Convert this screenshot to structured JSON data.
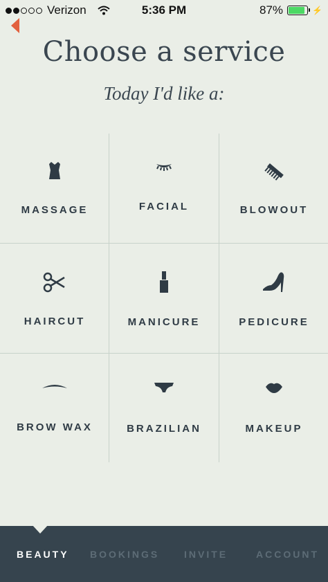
{
  "status_bar": {
    "carrier": "Verizon",
    "time": "5:36 PM",
    "battery_percent": "87%",
    "battery_level": 0.87
  },
  "header": {
    "title": "Choose a service",
    "subtitle": "Today I'd like a:",
    "back_icon": "chevron-left-icon"
  },
  "services": [
    {
      "label": "MASSAGE",
      "icon": "corset-icon"
    },
    {
      "label": "FACIAL",
      "icon": "eyelash-icon"
    },
    {
      "label": "BLOWOUT",
      "icon": "comb-icon"
    },
    {
      "label": "HAIRCUT",
      "icon": "scissors-icon"
    },
    {
      "label": "MANICURE",
      "icon": "nail-polish-icon"
    },
    {
      "label": "PEDICURE",
      "icon": "high-heel-icon"
    },
    {
      "label": "BROW WAX",
      "icon": "eyebrow-icon"
    },
    {
      "label": "BRAZILIAN",
      "icon": "underwear-icon"
    },
    {
      "label": "MAKEUP",
      "icon": "lips-icon"
    }
  ],
  "tabs": [
    {
      "label": "BEAUTY",
      "active": true
    },
    {
      "label": "BOOKINGS",
      "active": false
    },
    {
      "label": "INVITE",
      "active": false
    },
    {
      "label": "ACCOUNT",
      "active": false
    }
  ],
  "colors": {
    "background": "#eaeee7",
    "text": "#2f3b45",
    "accent": "#e2603e",
    "tabbar": "#36444e",
    "battery": "#4cd964"
  }
}
